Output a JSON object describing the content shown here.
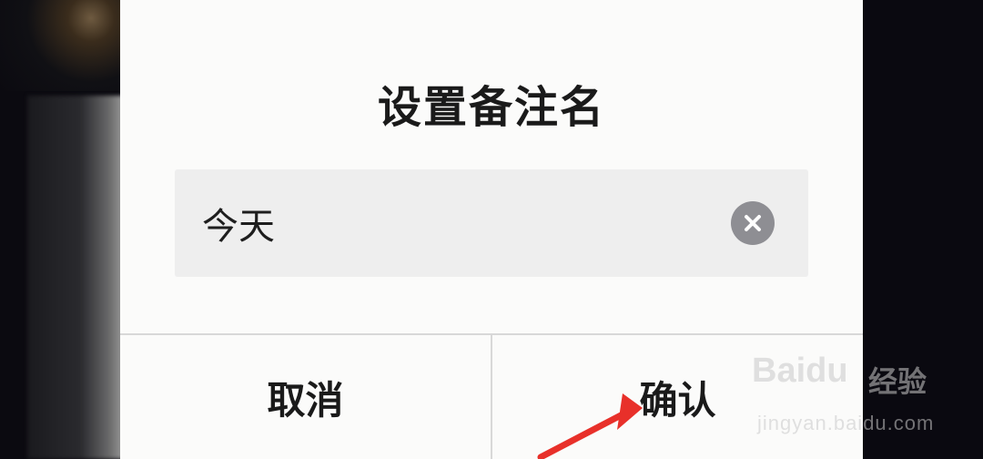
{
  "dialog": {
    "title": "设置备注名",
    "input": {
      "value": "今天",
      "placeholder": ""
    },
    "buttons": {
      "cancel": "取消",
      "confirm": "确认"
    }
  },
  "watermark": {
    "logo": "Baidu",
    "text": "经验",
    "url": "jingyan.baidu.com"
  },
  "icons": {
    "clear": "clear-icon",
    "annotation": "red-arrow-icon"
  },
  "colors": {
    "dialog_bg": "#fbfbfa",
    "input_bg": "#eeeeee",
    "clear_bg": "#8e8e93",
    "arrow": "#e8302a"
  }
}
